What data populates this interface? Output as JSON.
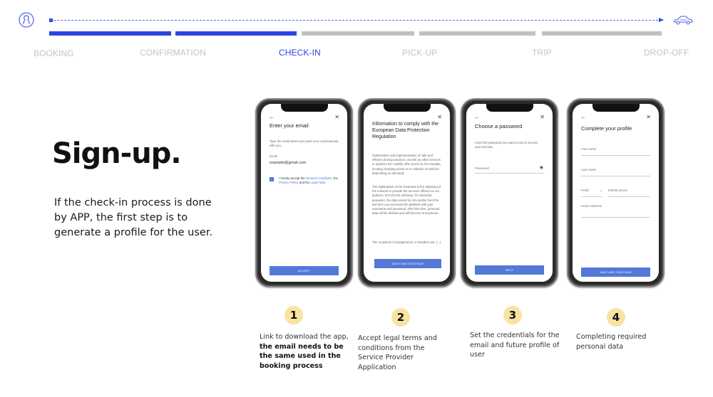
{
  "progress": {
    "stages": [
      {
        "label": "BOOKING",
        "state": "done"
      },
      {
        "label": "CONFIRMATION",
        "state": "done"
      },
      {
        "label": "CHECK-IN",
        "state": "active"
      },
      {
        "label": "PICK-UP",
        "state": "todo"
      },
      {
        "label": "TRIP",
        "state": "todo"
      },
      {
        "label": "DROP-OFF",
        "state": "todo"
      }
    ],
    "completed_segments": 2,
    "total_segments": 5,
    "start_icon": "user-icon",
    "end_icon": "car-icon",
    "colors": {
      "active": "#2b46e0",
      "inactive": "#c1c1c1",
      "label_inactive": "#c4c4c4"
    }
  },
  "intro": {
    "title": "Sign-up.",
    "description": "If the check-in process is done by APP, the first step is to generate a profile for the user."
  },
  "screens": [
    {
      "title": "Enter your email",
      "intro": "Type the email where you want us to communicate with you.",
      "email_label": "Email",
      "email_value": "example@gmail.com",
      "consent_prefix": "I hereby accept the ",
      "consent_link1": "General Conditions",
      "consent_mid1": ", the ",
      "consent_link2": "Privacy Policy",
      "consent_mid2": ", and the ",
      "consent_link3": "Legal Note",
      "consent_end": ".",
      "checkbox_checked": true,
      "button": "ACCEPT"
    },
    {
      "title": "Information to comply with the European Data Protection Regulation",
      "para1": "Optimization and implementation of safe and efficient driving solutions, as well as other services to optimize the mobility offer (such as, for example, locating charging points or re-collation of vehicles depending on demand).",
      "para2": "The legitimation of the treatment is the obtaining of the consent to provide the services offered on our platform. ECCOCAR will keep, for statistical purposes, the data stored for 48 months from the last time you accessed the platform with your username and password. After this time, personal data will be deleted and will become anonymous.",
      "para3": "The recipients of assignments or transfers are: (...)",
      "button": "SAVE AND CONTINUE"
    },
    {
      "title": "Choose a password",
      "intro": "Insert the password you want to use to access your account.",
      "password_label": "Password",
      "button": "NEXT"
    },
    {
      "title": "Complete your profile",
      "first_name_label": "First name",
      "last_name_label": "Last name",
      "prefix_label": "Prefix",
      "mobile_label": "Mobile phone",
      "address_label": "Home address",
      "button": "SAVE AND CONTINUE"
    }
  ],
  "steps": [
    {
      "number": "1",
      "text": "Link to download the app, ",
      "bold": "the email needs to be the same used in the booking process"
    },
    {
      "number": "2",
      "text": "Accept legal terms and conditions from the Service Provider Application",
      "bold": ""
    },
    {
      "number": "3",
      "text": "Set the credentials for the email and future profile of user",
      "bold": ""
    },
    {
      "number": "4",
      "text": "Completing required personal data",
      "bold": ""
    }
  ]
}
